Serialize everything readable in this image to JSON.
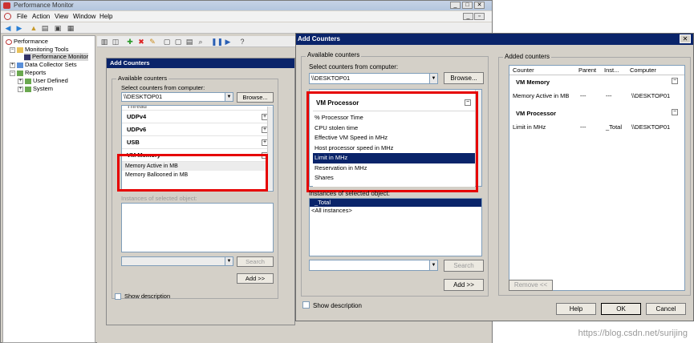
{
  "pm": {
    "title": "Performance Monitor",
    "menus": [
      "File",
      "Action",
      "View",
      "Window",
      "Help"
    ],
    "tree": {
      "root": "Performance",
      "monitoring_tools": "Monitoring Tools",
      "performance_monitor": "Performance Monitor",
      "data_collector_sets": "Data Collector Sets",
      "reports": "Reports",
      "user_defined": "User Defined",
      "system": "System"
    }
  },
  "bg_dialog": {
    "title": "Add Counters",
    "available_counters": "Available counters",
    "select_from_computer": "Select counters from computer:",
    "computer": "\\\\DESKTOP01",
    "browse": "Browse...",
    "partial_item": "Thread",
    "objects": [
      "UDPv4",
      "UDPv6",
      "USB"
    ],
    "vm_memory": "VM Memory",
    "vm_memory_counters": [
      "Memory Active in MB",
      "Memory Ballooned in MB"
    ],
    "instances_label": "Instances of selected object:",
    "search": "Search",
    "add": "Add >>",
    "show_description": "Show description",
    "expander": "+",
    "collapser": "−"
  },
  "fg_dialog": {
    "title": "Add Counters",
    "available_counters": "Available counters",
    "select_from_computer": "Select counters from computer:",
    "computer": "\\\\DESKTOP01",
    "browse": "Browse...",
    "object": "VM Processor",
    "collapser": "−",
    "counters": [
      "% Processor Time",
      "CPU stolen time",
      "Effective VM Speed in MHz",
      "Host processor speed in MHz",
      "Limit in MHz",
      "Reservation in MHz",
      "Shares"
    ],
    "selected_counter": "Limit in MHz",
    "instances_label": "Instances of selected object:",
    "instances": [
      "_Total",
      "<All instances>"
    ],
    "search": "Search",
    "add": "Add >>",
    "show_description": "Show description",
    "added_counters": "Added counters",
    "table_headers": {
      "counter": "Counter",
      "parent": "Parent",
      "instance": "Inst...",
      "computer": "Computer"
    },
    "added": [
      {
        "object": "VM Memory",
        "counter": "Memory Active in MB",
        "parent": "---",
        "instance": "---",
        "computer": "\\\\DESKTOP01"
      },
      {
        "object": "VM Processor",
        "counter": "Limit in MHz",
        "parent": "---",
        "instance": "_Total",
        "computer": "\\\\DESKTOP01"
      }
    ],
    "remove": "Remove <<",
    "help": "Help",
    "ok": "OK",
    "cancel": "Cancel",
    "close": "✕"
  },
  "watermark": "https://blog.csdn.net/surijing"
}
